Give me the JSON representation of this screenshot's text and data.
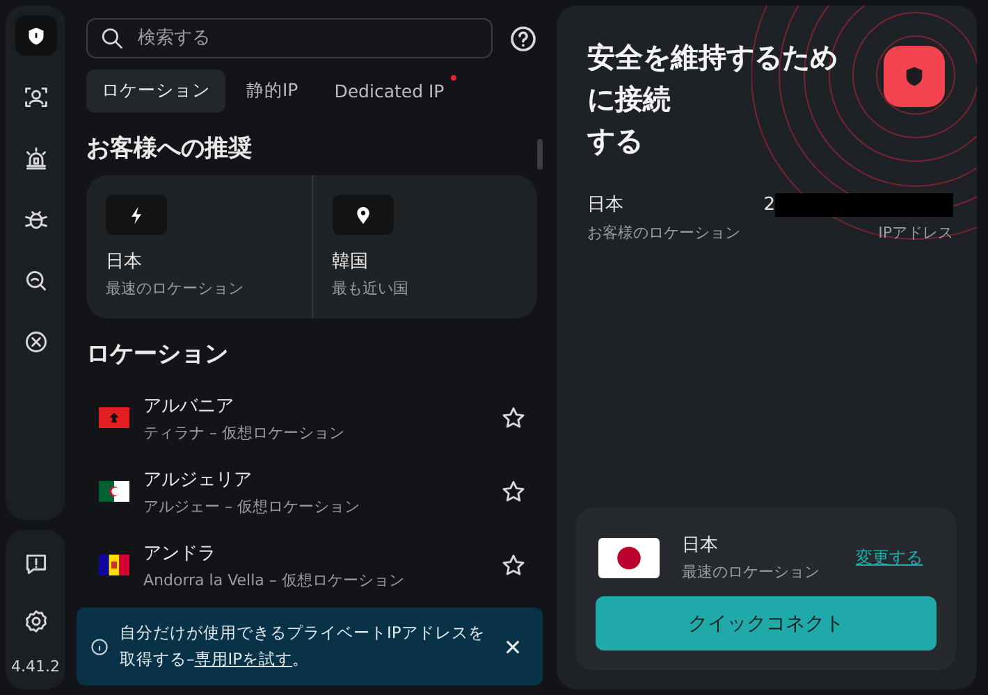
{
  "rail": {
    "items": [
      {
        "selected": true
      },
      {
        "selected": false
      },
      {
        "selected": false
      },
      {
        "selected": false
      },
      {
        "selected": false
      },
      {
        "selected": false
      }
    ],
    "version": "4.41.2"
  },
  "search": {
    "placeholder": "検索する"
  },
  "tabs": [
    {
      "label": "ロケーション",
      "selected": true,
      "badge": false
    },
    {
      "label": "静的IP",
      "selected": false,
      "badge": false
    },
    {
      "label": "Dedicated IP",
      "selected": false,
      "badge": true
    }
  ],
  "recommend": {
    "title": "お客様への推奨",
    "items": [
      {
        "name": "日本",
        "detail": "最速のロケーション"
      },
      {
        "name": "韓国",
        "detail": "最も近い国"
      }
    ]
  },
  "locations": {
    "title": "ロケーション",
    "items": [
      {
        "name": "アルバニア",
        "detail": "ティラナ – 仮想ロケーション",
        "favorite": false
      },
      {
        "name": "アルジェリア",
        "detail": "アルジェー – 仮想ロケーション",
        "favorite": false
      },
      {
        "name": "アンドラ",
        "detail": "Andorra la Vella – 仮想ロケーション",
        "favorite": false
      }
    ]
  },
  "banner": {
    "text": "自分だけが使用できるプライベートIPアドレスを取得する–",
    "link": "専用IPを試す",
    "end": "。"
  },
  "status": {
    "headline": [
      "安全を維持するため",
      "に**接続**",
      "する"
    ],
    "location": "日本",
    "location_label": "お客様のロケーション",
    "ip": "2",
    "ip_label": "IPアドレス"
  },
  "connect": {
    "name": "日本",
    "detail": "最速のロケーション",
    "change": "変更する",
    "button": "クイックコネクト"
  }
}
